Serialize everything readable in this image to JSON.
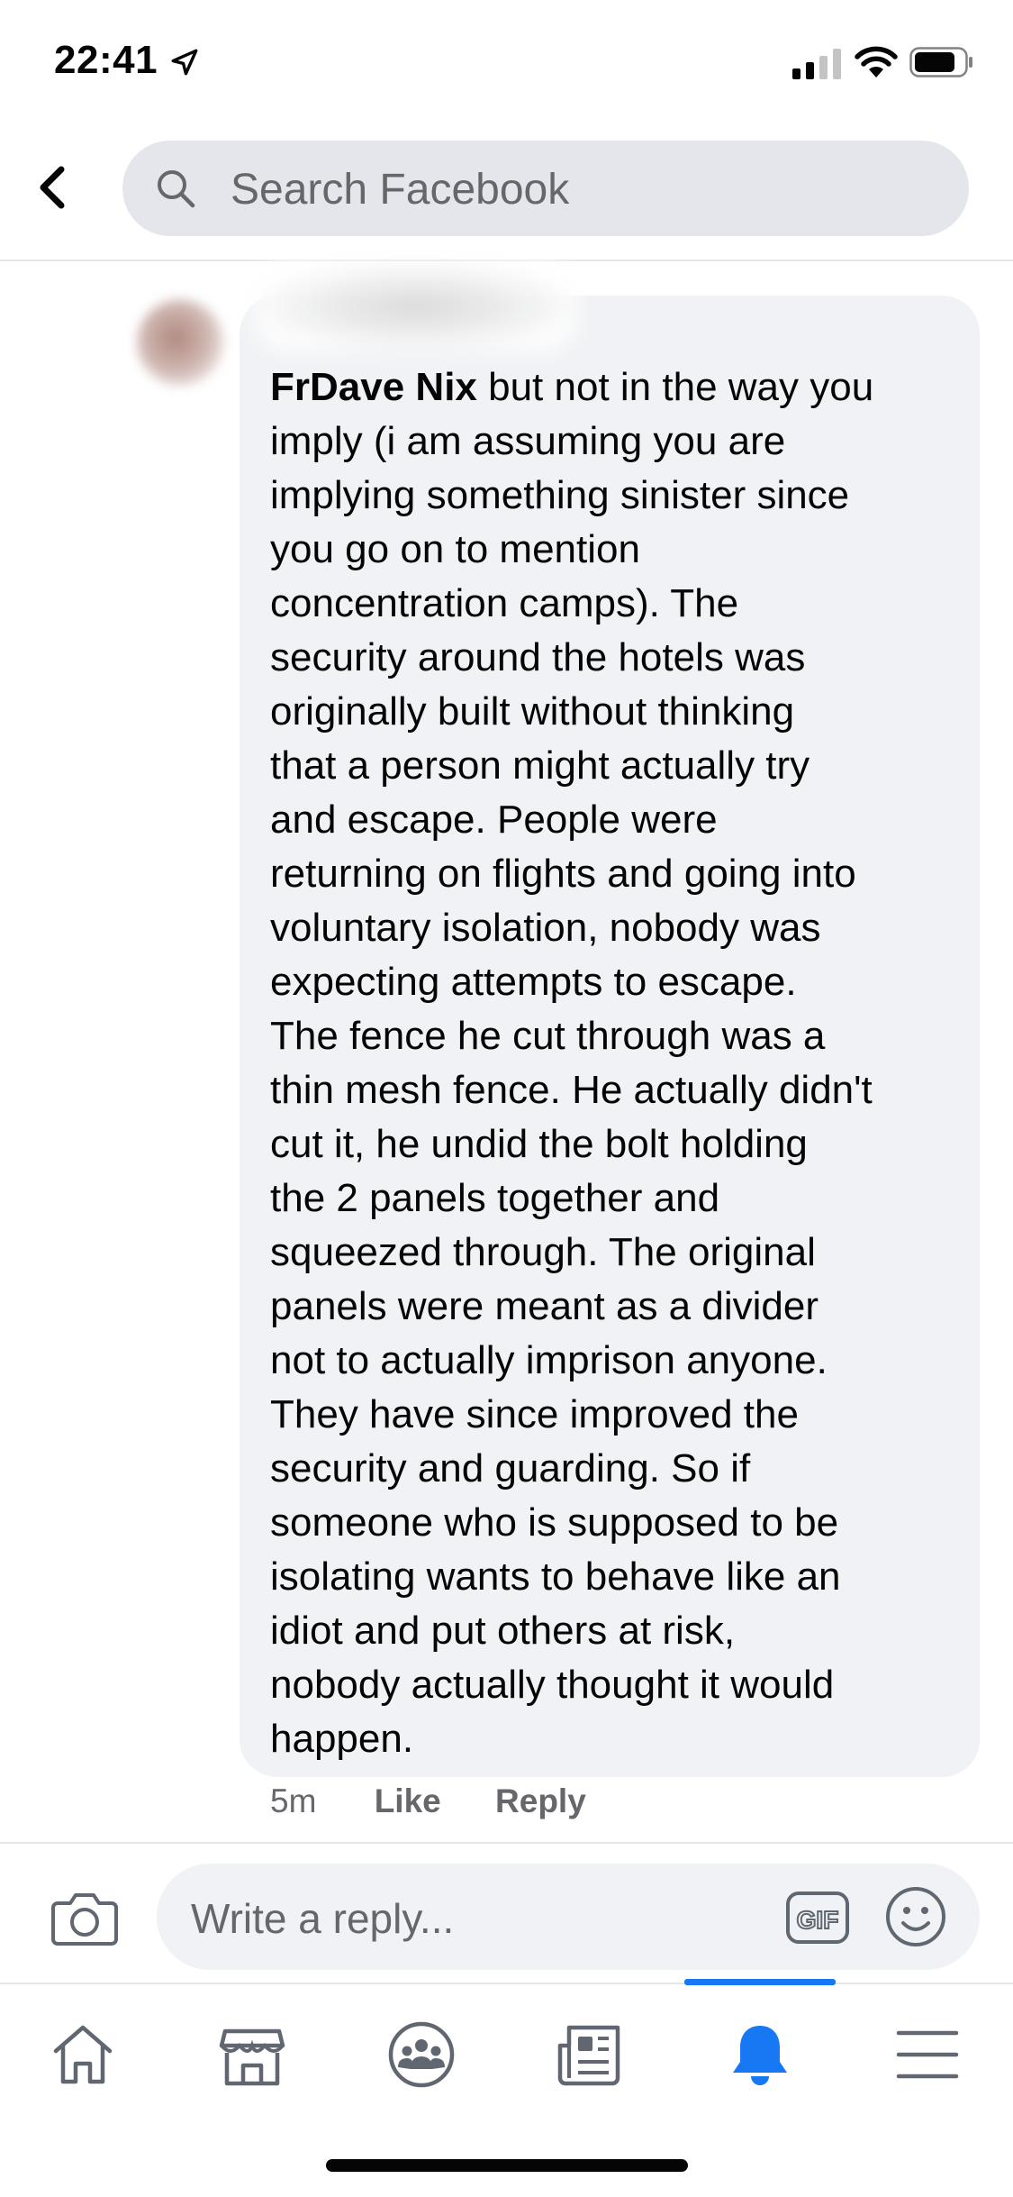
{
  "status_bar": {
    "time": "22:41"
  },
  "search": {
    "placeholder": "Search Facebook"
  },
  "comment": {
    "author": "FrDave Nix",
    "lines": [
      " but not in the way you",
      "imply (i am assuming you are",
      "implying something sinister since",
      "you go on to mention",
      "concentration camps). The",
      "security around the hotels was",
      "originally built without thinking",
      "that a person might actually try",
      "and escape. People were",
      "returning on flights and going into",
      "voluntary isolation, nobody was",
      "expecting attempts to escape.",
      "The fence he cut through was a",
      "thin mesh fence. He actually didn't",
      "cut it, he undid the bolt holding",
      "the 2 panels together and",
      "squeezed through. The original",
      "panels were meant as a divider",
      "not to actually imprison anyone.",
      "They have since improved the",
      "security and guarding. So if",
      "someone who is supposed to be",
      "isolating wants to behave like an",
      "idiot and put others at risk,",
      "nobody actually thought it would",
      "happen."
    ],
    "time_ago": "5m",
    "like_label": "Like",
    "reply_label": "Reply"
  },
  "composer": {
    "placeholder": "Write a reply...",
    "gif_label": "GIF"
  },
  "tabs": {
    "items": [
      "home-icon",
      "marketplace-icon",
      "groups-icon",
      "news-icon",
      "notifications-icon",
      "menu-icon"
    ],
    "active": "notifications-icon",
    "active_color": "#1877f2"
  },
  "colors": {
    "accent": "#1877f2",
    "bubble": "#f0f2f5",
    "secondary_text": "#65676b"
  }
}
